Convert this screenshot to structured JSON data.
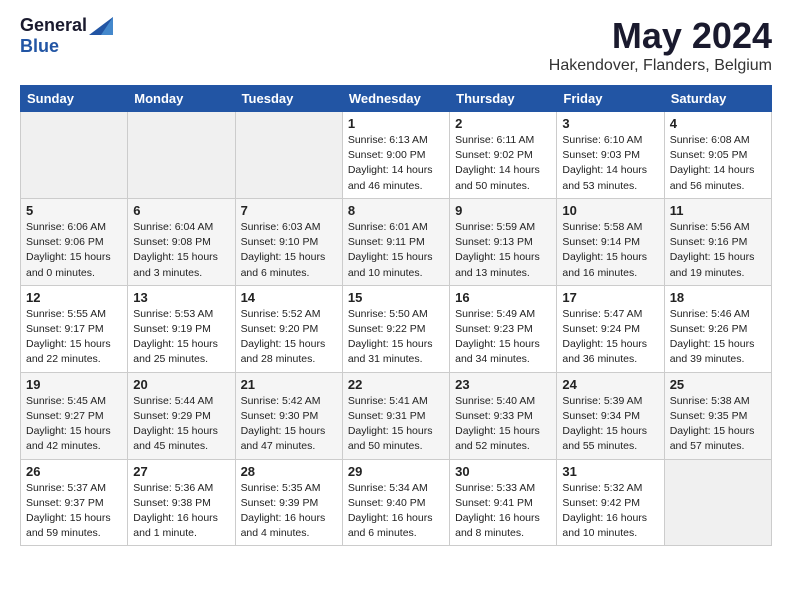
{
  "header": {
    "logo_general": "General",
    "logo_blue": "Blue",
    "title": "May 2024",
    "location": "Hakendover, Flanders, Belgium"
  },
  "days_of_week": [
    "Sunday",
    "Monday",
    "Tuesday",
    "Wednesday",
    "Thursday",
    "Friday",
    "Saturday"
  ],
  "weeks": [
    [
      {
        "day": "",
        "info": ""
      },
      {
        "day": "",
        "info": ""
      },
      {
        "day": "",
        "info": ""
      },
      {
        "day": "1",
        "info": "Sunrise: 6:13 AM\nSunset: 9:00 PM\nDaylight: 14 hours\nand 46 minutes."
      },
      {
        "day": "2",
        "info": "Sunrise: 6:11 AM\nSunset: 9:02 PM\nDaylight: 14 hours\nand 50 minutes."
      },
      {
        "day": "3",
        "info": "Sunrise: 6:10 AM\nSunset: 9:03 PM\nDaylight: 14 hours\nand 53 minutes."
      },
      {
        "day": "4",
        "info": "Sunrise: 6:08 AM\nSunset: 9:05 PM\nDaylight: 14 hours\nand 56 minutes."
      }
    ],
    [
      {
        "day": "5",
        "info": "Sunrise: 6:06 AM\nSunset: 9:06 PM\nDaylight: 15 hours\nand 0 minutes."
      },
      {
        "day": "6",
        "info": "Sunrise: 6:04 AM\nSunset: 9:08 PM\nDaylight: 15 hours\nand 3 minutes."
      },
      {
        "day": "7",
        "info": "Sunrise: 6:03 AM\nSunset: 9:10 PM\nDaylight: 15 hours\nand 6 minutes."
      },
      {
        "day": "8",
        "info": "Sunrise: 6:01 AM\nSunset: 9:11 PM\nDaylight: 15 hours\nand 10 minutes."
      },
      {
        "day": "9",
        "info": "Sunrise: 5:59 AM\nSunset: 9:13 PM\nDaylight: 15 hours\nand 13 minutes."
      },
      {
        "day": "10",
        "info": "Sunrise: 5:58 AM\nSunset: 9:14 PM\nDaylight: 15 hours\nand 16 minutes."
      },
      {
        "day": "11",
        "info": "Sunrise: 5:56 AM\nSunset: 9:16 PM\nDaylight: 15 hours\nand 19 minutes."
      }
    ],
    [
      {
        "day": "12",
        "info": "Sunrise: 5:55 AM\nSunset: 9:17 PM\nDaylight: 15 hours\nand 22 minutes."
      },
      {
        "day": "13",
        "info": "Sunrise: 5:53 AM\nSunset: 9:19 PM\nDaylight: 15 hours\nand 25 minutes."
      },
      {
        "day": "14",
        "info": "Sunrise: 5:52 AM\nSunset: 9:20 PM\nDaylight: 15 hours\nand 28 minutes."
      },
      {
        "day": "15",
        "info": "Sunrise: 5:50 AM\nSunset: 9:22 PM\nDaylight: 15 hours\nand 31 minutes."
      },
      {
        "day": "16",
        "info": "Sunrise: 5:49 AM\nSunset: 9:23 PM\nDaylight: 15 hours\nand 34 minutes."
      },
      {
        "day": "17",
        "info": "Sunrise: 5:47 AM\nSunset: 9:24 PM\nDaylight: 15 hours\nand 36 minutes."
      },
      {
        "day": "18",
        "info": "Sunrise: 5:46 AM\nSunset: 9:26 PM\nDaylight: 15 hours\nand 39 minutes."
      }
    ],
    [
      {
        "day": "19",
        "info": "Sunrise: 5:45 AM\nSunset: 9:27 PM\nDaylight: 15 hours\nand 42 minutes."
      },
      {
        "day": "20",
        "info": "Sunrise: 5:44 AM\nSunset: 9:29 PM\nDaylight: 15 hours\nand 45 minutes."
      },
      {
        "day": "21",
        "info": "Sunrise: 5:42 AM\nSunset: 9:30 PM\nDaylight: 15 hours\nand 47 minutes."
      },
      {
        "day": "22",
        "info": "Sunrise: 5:41 AM\nSunset: 9:31 PM\nDaylight: 15 hours\nand 50 minutes."
      },
      {
        "day": "23",
        "info": "Sunrise: 5:40 AM\nSunset: 9:33 PM\nDaylight: 15 hours\nand 52 minutes."
      },
      {
        "day": "24",
        "info": "Sunrise: 5:39 AM\nSunset: 9:34 PM\nDaylight: 15 hours\nand 55 minutes."
      },
      {
        "day": "25",
        "info": "Sunrise: 5:38 AM\nSunset: 9:35 PM\nDaylight: 15 hours\nand 57 minutes."
      }
    ],
    [
      {
        "day": "26",
        "info": "Sunrise: 5:37 AM\nSunset: 9:37 PM\nDaylight: 15 hours\nand 59 minutes."
      },
      {
        "day": "27",
        "info": "Sunrise: 5:36 AM\nSunset: 9:38 PM\nDaylight: 16 hours\nand 1 minute."
      },
      {
        "day": "28",
        "info": "Sunrise: 5:35 AM\nSunset: 9:39 PM\nDaylight: 16 hours\nand 4 minutes."
      },
      {
        "day": "29",
        "info": "Sunrise: 5:34 AM\nSunset: 9:40 PM\nDaylight: 16 hours\nand 6 minutes."
      },
      {
        "day": "30",
        "info": "Sunrise: 5:33 AM\nSunset: 9:41 PM\nDaylight: 16 hours\nand 8 minutes."
      },
      {
        "day": "31",
        "info": "Sunrise: 5:32 AM\nSunset: 9:42 PM\nDaylight: 16 hours\nand 10 minutes."
      },
      {
        "day": "",
        "info": ""
      }
    ]
  ]
}
